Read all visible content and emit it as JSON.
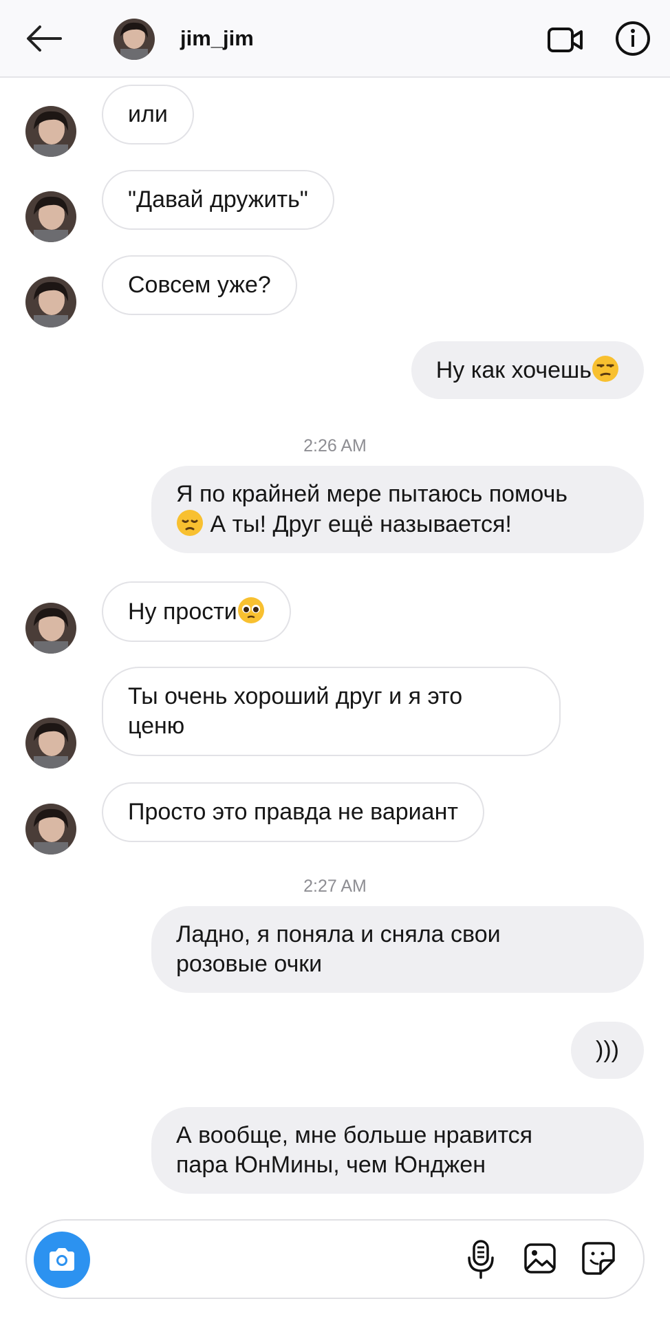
{
  "header": {
    "username": "jim_jim"
  },
  "messages": {
    "m1": "или",
    "m2": "\"Давай дружить\"",
    "m3": "Совсем уже?",
    "m4": "Ну как хочешь",
    "m5_l1": "Я по крайней мере пытаюсь помочь",
    "m5_l2": " А ты! Друг ещё называется!",
    "m6": "Ну прости",
    "m7_l1": "Ты очень хороший друг и я это",
    "m7_l2": "ценю",
    "m8": "Просто это правда не вариант",
    "m9_l1": "Ладно, я поняла и сняла свои",
    "m9_l2": "розовые очки",
    "m10": ")))",
    "m11_l1": "А вообще, мне больше нравится",
    "m11_l2": "пара ЮнМины, чем Юнджен"
  },
  "timestamps": {
    "t1": "2:26 AM",
    "t2": "2:27 AM"
  },
  "icons": {
    "back": "arrow-left-icon",
    "video": "video-call-icon",
    "info": "info-icon",
    "camera": "camera-icon",
    "mic": "microphone-icon",
    "gallery": "gallery-icon",
    "sticker": "sticker-icon"
  },
  "colors": {
    "accent": "#2c92f0",
    "outgoing_bubble": "#efeff2",
    "header_bg": "#f9f9fb"
  }
}
